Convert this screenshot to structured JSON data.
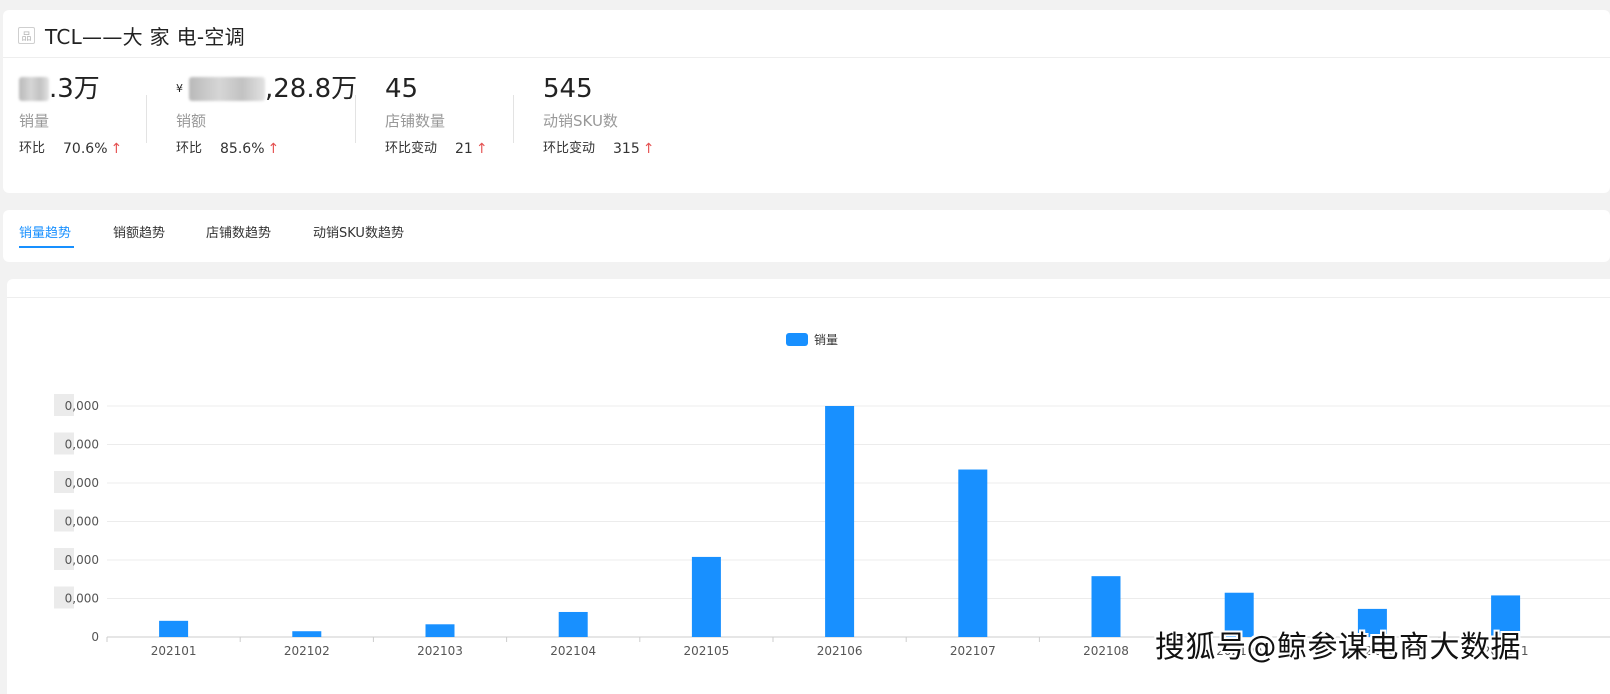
{
  "header": {
    "category_icon": "category-icon",
    "title": "TCL——大 家 电-空调"
  },
  "metrics": [
    {
      "value_suffix": ".3万",
      "currency": "",
      "label": "销量",
      "change_label": "环比",
      "change_value": "70.6%",
      "change_dir": "up"
    },
    {
      "value_suffix": ",28.8万",
      "currency": "¥",
      "label": "销额",
      "change_label": "环比",
      "change_value": "85.6%",
      "change_dir": "up"
    },
    {
      "value_suffix": "45",
      "currency": "",
      "label": "店铺数量",
      "change_label": "环比变动",
      "change_value": "21",
      "change_dir": "up"
    },
    {
      "value_suffix": "545",
      "currency": "",
      "label": "动销SKU数",
      "change_label": "环比变动",
      "change_value": "315",
      "change_dir": "up"
    }
  ],
  "tabs": [
    {
      "label": "销量趋势",
      "active": true
    },
    {
      "label": "销额趋势",
      "active": false
    },
    {
      "label": "店铺数趋势",
      "active": false
    },
    {
      "label": "动销SKU数趋势",
      "active": false
    }
  ],
  "colors": {
    "accent": "#1890ff",
    "bar": "#1890ff",
    "up": "#e55353"
  },
  "chart_data": {
    "type": "bar",
    "legend": [
      "销量"
    ],
    "legend_position": "top-center",
    "categories": [
      "202101",
      "202102",
      "202103",
      "202104",
      "202105",
      "202106",
      "202107",
      "202108",
      "202109",
      "202110",
      "202111"
    ],
    "series": [
      {
        "name": "销量",
        "values": [
          4.2,
          1.5,
          3.3,
          6.5,
          20.8,
          60,
          43.5,
          15.8,
          11.5,
          7.3,
          10.8
        ]
      }
    ],
    "y_tick_labels": [
      "0",
      "0,000",
      "0,000",
      "0,000",
      "0,000",
      "0,000",
      "0,000"
    ],
    "ylim": [
      0,
      60
    ],
    "grid": true
  },
  "watermark": "搜狐号@鲸参谋电商大数据"
}
